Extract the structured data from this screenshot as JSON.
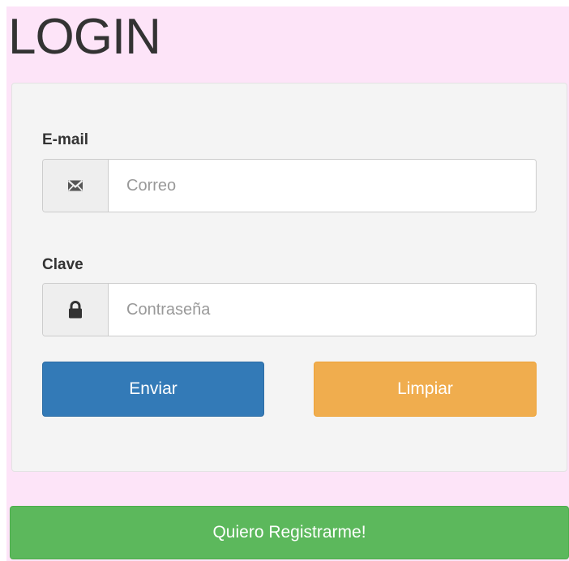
{
  "title": "LOGIN",
  "form": {
    "email": {
      "label": "E-mail",
      "icon": "envelope-icon",
      "placeholder": "Correo",
      "value": ""
    },
    "password": {
      "label": "Clave",
      "icon": "lock-icon",
      "placeholder": "Contraseña",
      "value": ""
    },
    "submit_label": "Enviar",
    "reset_label": "Limpiar"
  },
  "register_label": "Quiero Registrarme!",
  "colors": {
    "page_background": "#fde4f8",
    "panel_background": "#f4f4f4",
    "primary": "#337ab7",
    "warning": "#f0ad4e",
    "success": "#5cb85c"
  }
}
